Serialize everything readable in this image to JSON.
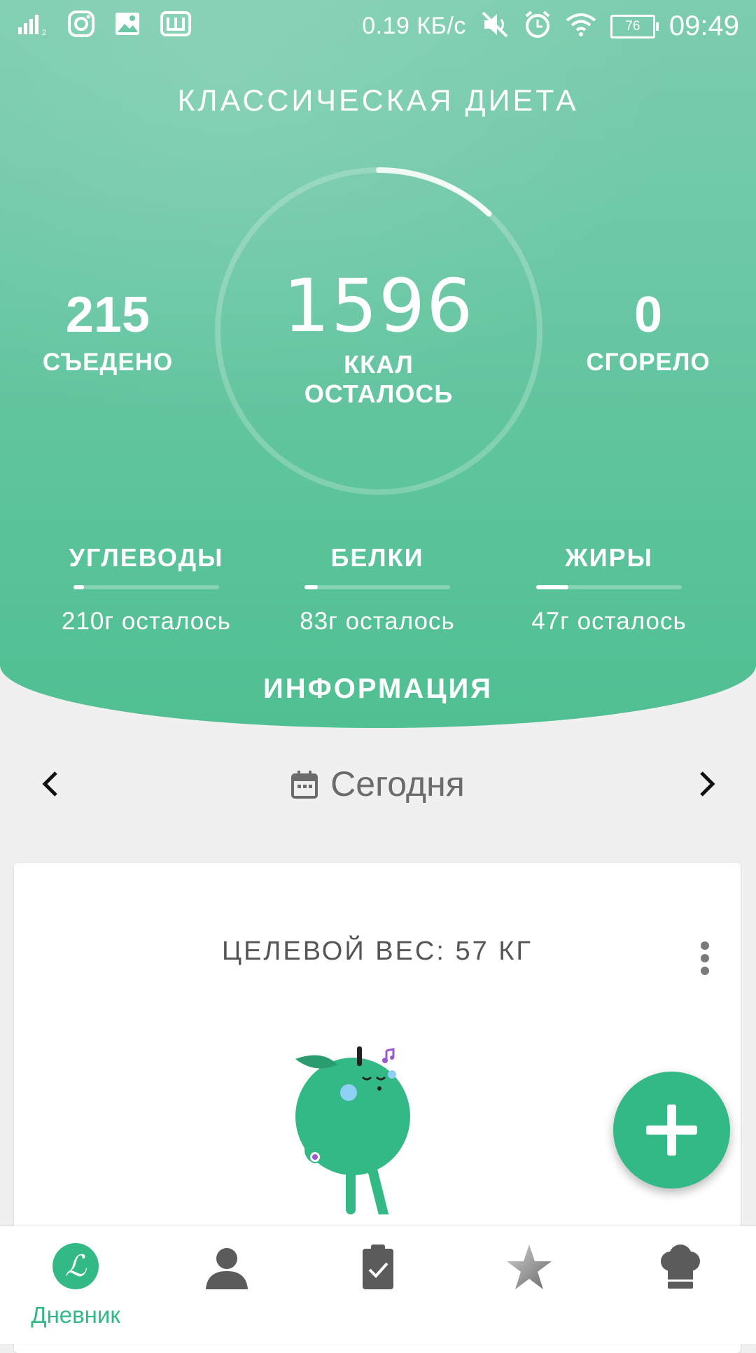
{
  "status_bar": {
    "speed": "0.19 КБ/с",
    "battery": "76",
    "time": "09:49",
    "icons": [
      "signal-icon",
      "instagram-icon",
      "gallery-icon",
      "app-w-icon",
      "mute-icon",
      "alarm-icon",
      "wifi-icon",
      "battery-icon"
    ]
  },
  "header": {
    "diet_title": "КЛАССИЧЕСКАЯ ДИЕТА",
    "eaten_value": "215",
    "eaten_label": "СЪЕДЕНО",
    "remaining_value": "1596",
    "remaining_label_line1": "ККАЛ",
    "remaining_label_line2": "ОСТАЛОСЬ",
    "burned_value": "0",
    "burned_label": "СГОРЕЛО",
    "ring_progress_fraction": 0.12
  },
  "macros": [
    {
      "title": "УГЛЕВОДЫ",
      "remaining": "210г осталось",
      "progress": 0.07
    },
    {
      "title": "БЕЛКИ",
      "remaining": "83г осталось",
      "progress": 0.09
    },
    {
      "title": "ЖИРЫ",
      "remaining": "47г осталось",
      "progress": 0.22
    }
  ],
  "info_label": "ИНФОРМАЦИЯ",
  "date_nav": {
    "label": "Сегодня"
  },
  "card": {
    "title": "ЦЕЛЕВОЙ ВЕС: 57 КГ"
  },
  "bottom_nav": {
    "active_label": "Дневник",
    "tabs": [
      "diary-icon",
      "profile-icon",
      "plan-clipboard-icon",
      "favorites-star-icon",
      "recipes-chef-hat-icon"
    ]
  },
  "colors": {
    "accent": "#33b985",
    "header_top": "#7ccdae",
    "header_bottom": "#50bf92"
  }
}
